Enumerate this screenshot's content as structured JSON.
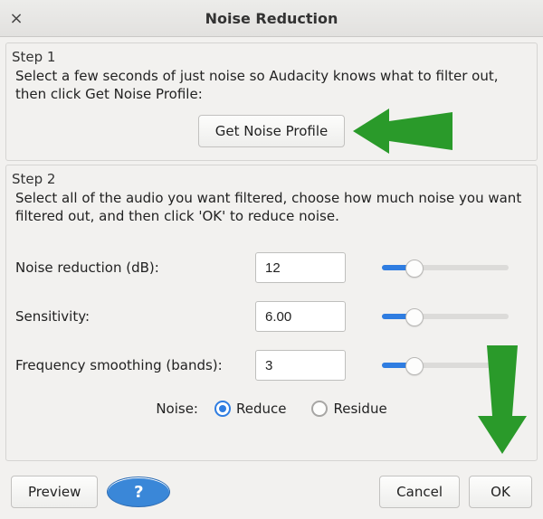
{
  "window": {
    "title": "Noise Reduction",
    "close_glyph": "×"
  },
  "step1": {
    "header": "Step 1",
    "instructions": "Select a few seconds of just noise so Audacity knows what to filter out, then click Get Noise Profile:",
    "button": "Get Noise Profile"
  },
  "step2": {
    "header": "Step 2",
    "instructions": "Select all of the audio you want filtered, choose how much noise you want filtered out, and then click 'OK' to reduce noise.",
    "params": {
      "noise_reduction": {
        "label": "Noise reduction (dB):",
        "value": "12",
        "fill_pct": 25
      },
      "sensitivity": {
        "label": "Sensitivity:",
        "value": "6.00",
        "fill_pct": 25
      },
      "freq_smoothing": {
        "label": "Frequency smoothing (bands):",
        "value": "3",
        "fill_pct": 25
      }
    },
    "noise_label": "Noise:",
    "radios": {
      "reduce": "Reduce",
      "residue": "Residue",
      "selected": "reduce"
    }
  },
  "buttons": {
    "preview": "Preview",
    "help_glyph": "?",
    "cancel": "Cancel",
    "ok": "OK"
  }
}
